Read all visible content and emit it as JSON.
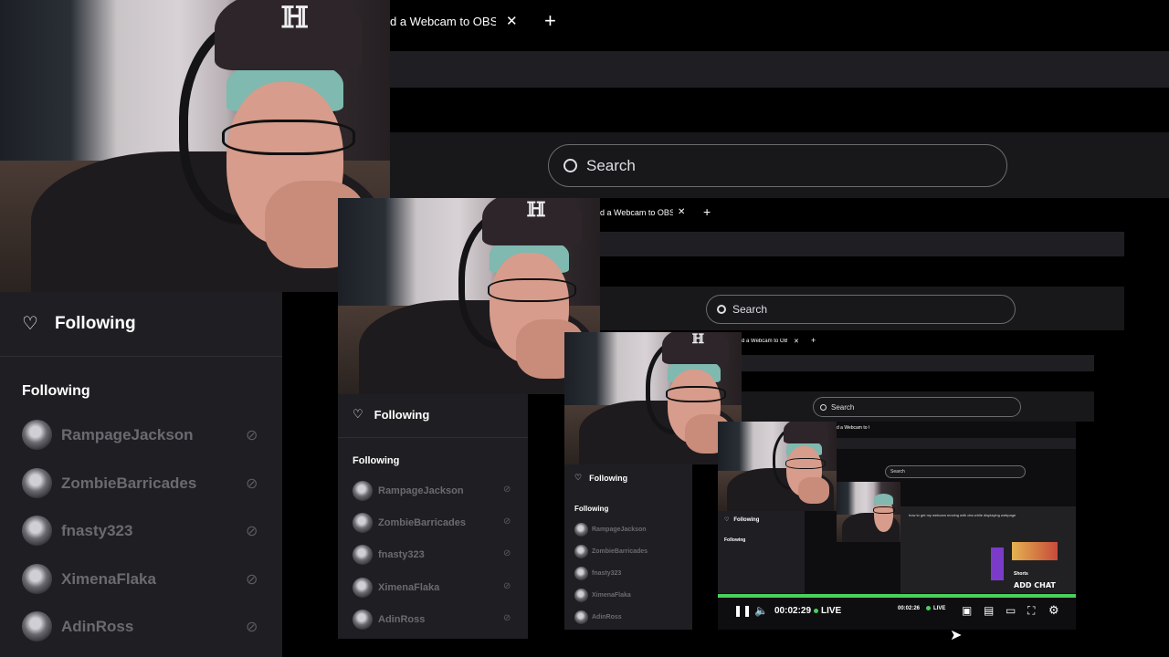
{
  "tab": {
    "title": "d a Webcam to OBS S",
    "close": "✕",
    "new": "+"
  },
  "search": {
    "placeholder": "Search"
  },
  "sidebar": {
    "header": "Following",
    "section": "Following",
    "channels": [
      {
        "name": "RampageJackson"
      },
      {
        "name": "ZombieBarricades"
      },
      {
        "name": "fnasty323"
      },
      {
        "name": "XimenaFlaka"
      },
      {
        "name": "AdinRoss"
      }
    ]
  },
  "nested_browser": {
    "tab_title": "how to get my webcam moving with obs while displaying webpage",
    "shorts": "Shorts",
    "pill": "Fitlam"
  },
  "player": {
    "elapsed": "00:02:29",
    "elapsed_inner": "00:02:26",
    "live": "LIVE",
    "progress_fraction": 1.0,
    "overlay_text": "ADD CHAT"
  },
  "colors": {
    "accent_green": "#4ad05e",
    "sidebar_bg": "#1f1f23",
    "text_muted": "#6a6a70"
  }
}
